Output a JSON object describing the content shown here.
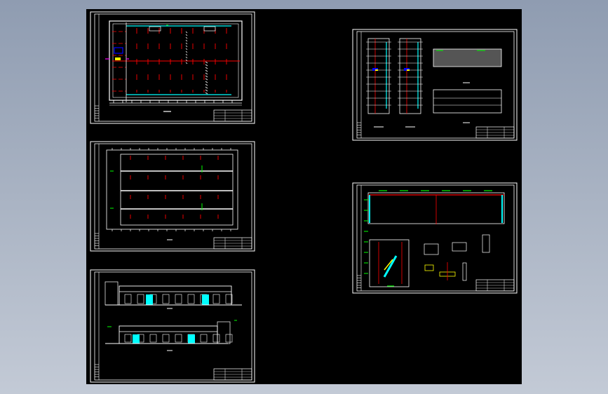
{
  "viewer": {
    "background": "#000000",
    "colors": {
      "frame": "#ffffff",
      "axis": "#ff0000",
      "dimension": "#00ff00",
      "glass": "#00ffff",
      "highlight": "#ffff00",
      "marker": "#ff00ff",
      "furniture": "#0000ff"
    },
    "sheets": [
      {
        "type": "floor-plan"
      },
      {
        "type": "roof-plan"
      },
      {
        "type": "elevations"
      },
      {
        "type": "stair-plans"
      },
      {
        "type": "section-details"
      }
    ]
  }
}
